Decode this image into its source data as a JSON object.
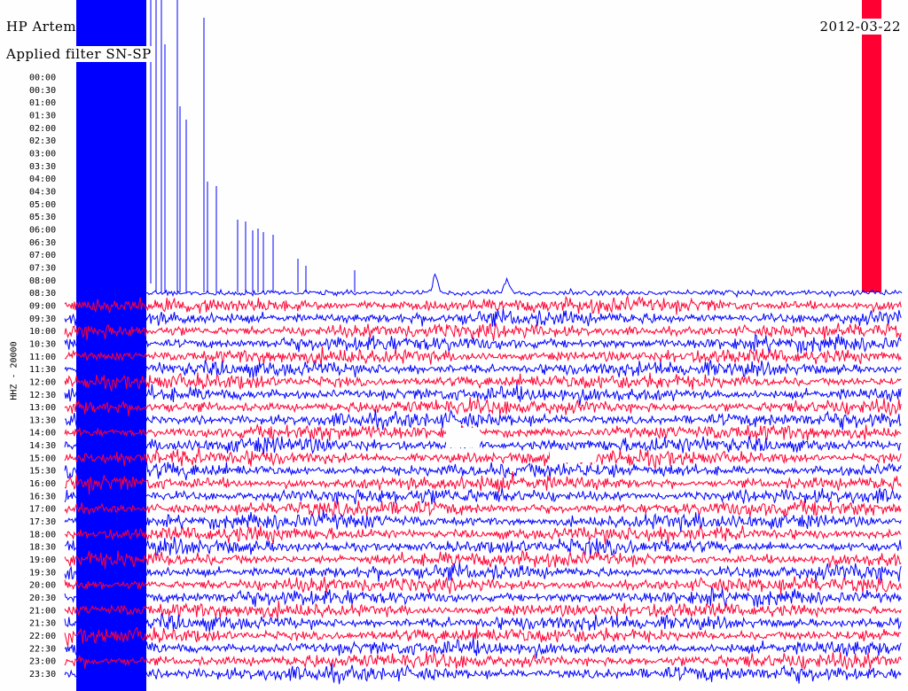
{
  "header": {
    "station": "HP Artem",
    "date": "2012-03-22",
    "filter_text": "Applied filter SN-SP"
  },
  "axis": {
    "ylabel": "HHZ - 20000"
  },
  "chart_data": {
    "type": "helicorder",
    "ylabel": "HHZ - 20000",
    "time_labels": [
      "00:00",
      "00:30",
      "01:00",
      "01:30",
      "02:00",
      "02:30",
      "03:00",
      "03:30",
      "04:00",
      "04:30",
      "05:00",
      "05:30",
      "06:00",
      "06:30",
      "07:00",
      "07:30",
      "08:00",
      "08:30",
      "09:00",
      "09:30",
      "10:00",
      "10:30",
      "11:00",
      "11:30",
      "12:00",
      "12:30",
      "13:00",
      "13:30",
      "14:00",
      "14:30",
      "15:00",
      "15:30",
      "16:00",
      "16:30",
      "17:00",
      "17:30",
      "18:00",
      "18:30",
      "19:00",
      "19:30",
      "20:00",
      "20:30",
      "21:00",
      "21:30",
      "22:00",
      "22:30",
      "23:00",
      "23:30"
    ],
    "active_from_trace": 18,
    "colors": [
      "#0000ff",
      "#ff0033"
    ],
    "background": "#fefefe"
  }
}
